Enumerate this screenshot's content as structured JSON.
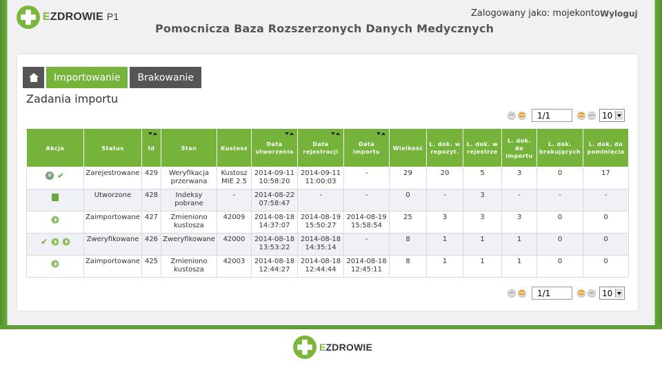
{
  "header": {
    "logo_text_e": "E",
    "logo_text_rest": "ZDROWIE",
    "logo_suffix": "P1",
    "login_info": "Zalogowany jako: mojekonto",
    "logout": "Wyloguj",
    "title": "Pomocnicza Baza Rozszerzonych Danych Medycznych"
  },
  "tabs": {
    "home_icon": "home-icon",
    "import": "Importowanie",
    "brak": "Brakowanie"
  },
  "section_title": "Zadania importu",
  "pager_top": {
    "page": "1/1",
    "page_size": "10"
  },
  "pager_bottom": {
    "page": "1/1",
    "page_size": "10"
  },
  "table": {
    "headers": [
      "Akcja",
      "Status",
      "Id",
      "Stan",
      "Kustosz",
      "Data utworzenia",
      "Data rejestracji",
      "Data importu",
      "Wielkość",
      "L. dok. w repozyt.",
      "L. dok. w rejestrze",
      "L. dok. do importu",
      "L. dok. brakujących",
      "L. dok. do pominięcia"
    ],
    "rows": [
      {
        "actions": [
          "gear-icon",
          "check-icon"
        ],
        "status": "Zarejestrowane",
        "id": "429",
        "stan": "Weryfikacja przerwana",
        "kustosz": "Kustosz MIE 2.5",
        "created": "2014-09-11 10:58:20",
        "registered": "2014-09-11 11:00:03",
        "imported": "-",
        "size": "29",
        "repo": "20",
        "registry": "5",
        "to_import": "3",
        "missing": "0",
        "skip": "17"
      },
      {
        "actions": [
          "document-icon"
        ],
        "status": "Utworzone",
        "id": "428",
        "stan": "Indeksy pobrane",
        "kustosz": "-",
        "created": "2014-08-22 07:58:47",
        "registered": "-",
        "imported": "-",
        "size": "0",
        "repo": "-",
        "registry": "3",
        "to_import": "-",
        "missing": "-",
        "skip": "-"
      },
      {
        "actions": [
          "play-icon"
        ],
        "status": "Zaimportowane",
        "id": "427",
        "stan": "Zmieniono kustosza",
        "kustosz": "42009",
        "created": "2014-08-18 14:37:07",
        "registered": "2014-08-19 15:50:27",
        "imported": "2014-08-19 15:58:54",
        "size": "25",
        "repo": "3",
        "registry": "3",
        "to_import": "3",
        "missing": "0",
        "skip": "0"
      },
      {
        "actions": [
          "check-icon",
          "play-icon",
          "play-icon"
        ],
        "status": "Zweryfikowane",
        "id": "426",
        "stan": "Zweryfikowane",
        "kustosz": "42000",
        "created": "2014-08-18 13:53:22",
        "registered": "2014-08-18 14:35:14",
        "imported": "-",
        "size": "8",
        "repo": "1",
        "registry": "1",
        "to_import": "1",
        "missing": "0",
        "skip": "0"
      },
      {
        "actions": [
          "play-icon"
        ],
        "status": "Zaimportowane",
        "id": "425",
        "stan": "Zmieniono kustosza",
        "kustosz": "42003",
        "created": "2014-08-18 12:44:27",
        "registered": "2014-08-18 12:44:44",
        "imported": "2014-08-18 12:45:11",
        "size": "8",
        "repo": "1",
        "registry": "1",
        "to_import": "1",
        "missing": "0",
        "skip": "0"
      }
    ]
  },
  "footer": {
    "logo_text_e": "E",
    "logo_text_rest": "ZDROWIE"
  },
  "colors": {
    "accent": "#76b33a",
    "dark_tab": "#555555",
    "row_alt": "#f0f0f7"
  }
}
